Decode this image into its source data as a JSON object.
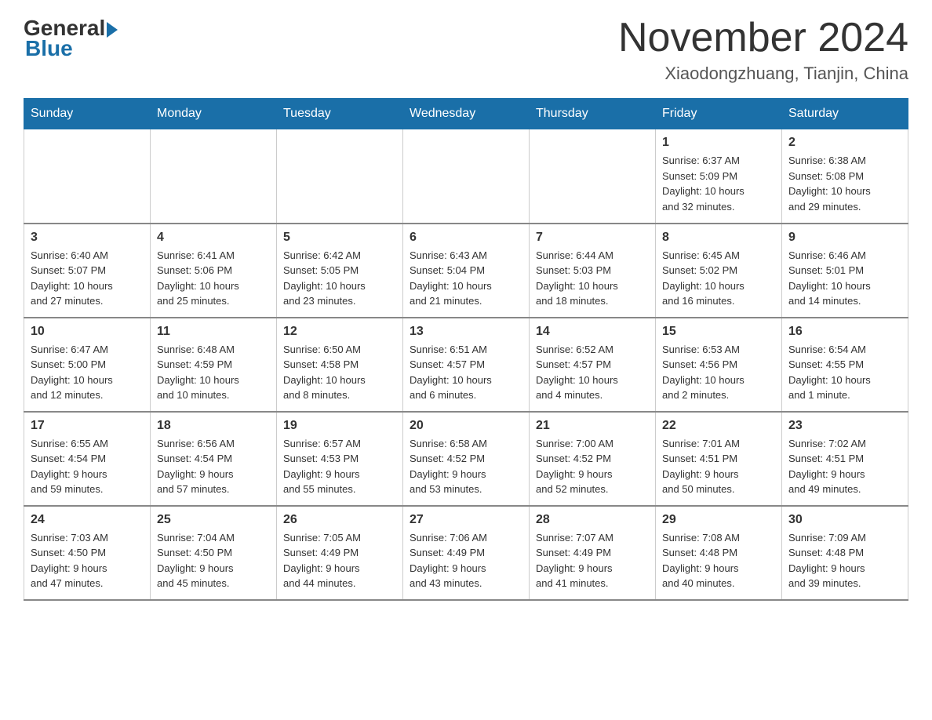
{
  "header": {
    "logo_general": "General",
    "logo_blue": "Blue",
    "month_title": "November 2024",
    "location": "Xiaodongzhuang, Tianjin, China"
  },
  "days_of_week": [
    "Sunday",
    "Monday",
    "Tuesday",
    "Wednesday",
    "Thursday",
    "Friday",
    "Saturday"
  ],
  "weeks": [
    [
      {
        "day": "",
        "info": ""
      },
      {
        "day": "",
        "info": ""
      },
      {
        "day": "",
        "info": ""
      },
      {
        "day": "",
        "info": ""
      },
      {
        "day": "",
        "info": ""
      },
      {
        "day": "1",
        "info": "Sunrise: 6:37 AM\nSunset: 5:09 PM\nDaylight: 10 hours\nand 32 minutes."
      },
      {
        "day": "2",
        "info": "Sunrise: 6:38 AM\nSunset: 5:08 PM\nDaylight: 10 hours\nand 29 minutes."
      }
    ],
    [
      {
        "day": "3",
        "info": "Sunrise: 6:40 AM\nSunset: 5:07 PM\nDaylight: 10 hours\nand 27 minutes."
      },
      {
        "day": "4",
        "info": "Sunrise: 6:41 AM\nSunset: 5:06 PM\nDaylight: 10 hours\nand 25 minutes."
      },
      {
        "day": "5",
        "info": "Sunrise: 6:42 AM\nSunset: 5:05 PM\nDaylight: 10 hours\nand 23 minutes."
      },
      {
        "day": "6",
        "info": "Sunrise: 6:43 AM\nSunset: 5:04 PM\nDaylight: 10 hours\nand 21 minutes."
      },
      {
        "day": "7",
        "info": "Sunrise: 6:44 AM\nSunset: 5:03 PM\nDaylight: 10 hours\nand 18 minutes."
      },
      {
        "day": "8",
        "info": "Sunrise: 6:45 AM\nSunset: 5:02 PM\nDaylight: 10 hours\nand 16 minutes."
      },
      {
        "day": "9",
        "info": "Sunrise: 6:46 AM\nSunset: 5:01 PM\nDaylight: 10 hours\nand 14 minutes."
      }
    ],
    [
      {
        "day": "10",
        "info": "Sunrise: 6:47 AM\nSunset: 5:00 PM\nDaylight: 10 hours\nand 12 minutes."
      },
      {
        "day": "11",
        "info": "Sunrise: 6:48 AM\nSunset: 4:59 PM\nDaylight: 10 hours\nand 10 minutes."
      },
      {
        "day": "12",
        "info": "Sunrise: 6:50 AM\nSunset: 4:58 PM\nDaylight: 10 hours\nand 8 minutes."
      },
      {
        "day": "13",
        "info": "Sunrise: 6:51 AM\nSunset: 4:57 PM\nDaylight: 10 hours\nand 6 minutes."
      },
      {
        "day": "14",
        "info": "Sunrise: 6:52 AM\nSunset: 4:57 PM\nDaylight: 10 hours\nand 4 minutes."
      },
      {
        "day": "15",
        "info": "Sunrise: 6:53 AM\nSunset: 4:56 PM\nDaylight: 10 hours\nand 2 minutes."
      },
      {
        "day": "16",
        "info": "Sunrise: 6:54 AM\nSunset: 4:55 PM\nDaylight: 10 hours\nand 1 minute."
      }
    ],
    [
      {
        "day": "17",
        "info": "Sunrise: 6:55 AM\nSunset: 4:54 PM\nDaylight: 9 hours\nand 59 minutes."
      },
      {
        "day": "18",
        "info": "Sunrise: 6:56 AM\nSunset: 4:54 PM\nDaylight: 9 hours\nand 57 minutes."
      },
      {
        "day": "19",
        "info": "Sunrise: 6:57 AM\nSunset: 4:53 PM\nDaylight: 9 hours\nand 55 minutes."
      },
      {
        "day": "20",
        "info": "Sunrise: 6:58 AM\nSunset: 4:52 PM\nDaylight: 9 hours\nand 53 minutes."
      },
      {
        "day": "21",
        "info": "Sunrise: 7:00 AM\nSunset: 4:52 PM\nDaylight: 9 hours\nand 52 minutes."
      },
      {
        "day": "22",
        "info": "Sunrise: 7:01 AM\nSunset: 4:51 PM\nDaylight: 9 hours\nand 50 minutes."
      },
      {
        "day": "23",
        "info": "Sunrise: 7:02 AM\nSunset: 4:51 PM\nDaylight: 9 hours\nand 49 minutes."
      }
    ],
    [
      {
        "day": "24",
        "info": "Sunrise: 7:03 AM\nSunset: 4:50 PM\nDaylight: 9 hours\nand 47 minutes."
      },
      {
        "day": "25",
        "info": "Sunrise: 7:04 AM\nSunset: 4:50 PM\nDaylight: 9 hours\nand 45 minutes."
      },
      {
        "day": "26",
        "info": "Sunrise: 7:05 AM\nSunset: 4:49 PM\nDaylight: 9 hours\nand 44 minutes."
      },
      {
        "day": "27",
        "info": "Sunrise: 7:06 AM\nSunset: 4:49 PM\nDaylight: 9 hours\nand 43 minutes."
      },
      {
        "day": "28",
        "info": "Sunrise: 7:07 AM\nSunset: 4:49 PM\nDaylight: 9 hours\nand 41 minutes."
      },
      {
        "day": "29",
        "info": "Sunrise: 7:08 AM\nSunset: 4:48 PM\nDaylight: 9 hours\nand 40 minutes."
      },
      {
        "day": "30",
        "info": "Sunrise: 7:09 AM\nSunset: 4:48 PM\nDaylight: 9 hours\nand 39 minutes."
      }
    ]
  ]
}
